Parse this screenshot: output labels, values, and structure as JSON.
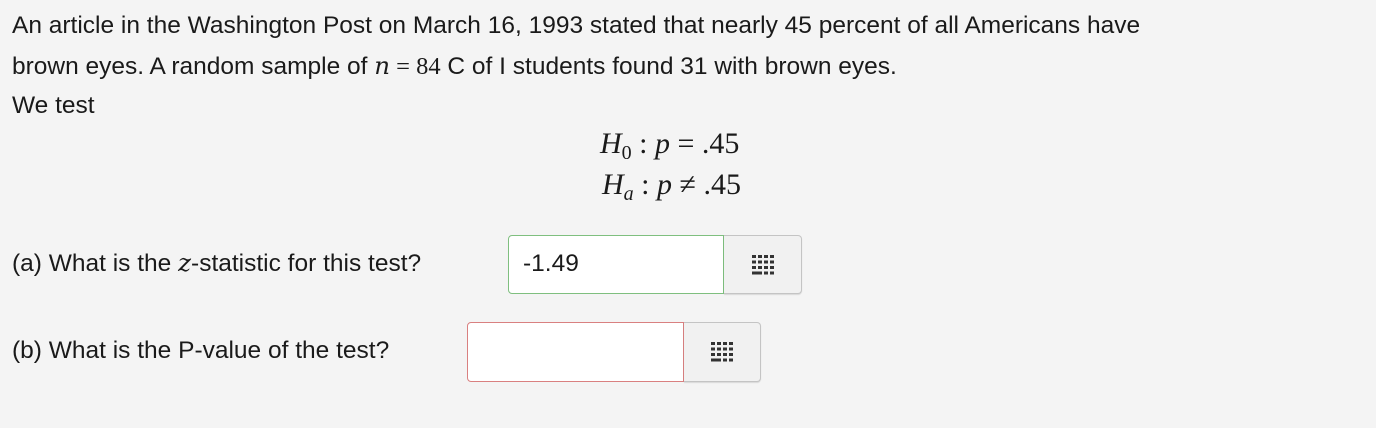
{
  "intro": {
    "line1": "An article in the Washington Post on March 16, 1993 stated that nearly 45 percent of all Americans have",
    "line2_before": "brown eyes. A random sample of ",
    "line2_var": "n",
    "line2_eq": " = 84",
    "line2_after": " C of I students found 31 with brown eyes.",
    "line3": "We test"
  },
  "hypotheses": {
    "h0": {
      "symbol": "H",
      "sub": "0",
      "rest": " : ",
      "var": "p",
      "relation": " = .45"
    },
    "ha": {
      "symbol": "H",
      "sub": "a",
      "rest": " : ",
      "var": "p",
      "relation": " ≠ .45"
    }
  },
  "question_a": {
    "before": "(a) What is the ",
    "var": "z",
    "after": "-statistic for this test?",
    "answer_value": "-1.49",
    "answer_status": "correct",
    "status_color": "#7fbf7f"
  },
  "question_b": {
    "label": "(b) What is the P-value of the test?",
    "answer_value": "",
    "answer_status": "incorrect",
    "status_color": "#d98080"
  },
  "icons": {
    "keypad": "keypad-grid-icon"
  }
}
